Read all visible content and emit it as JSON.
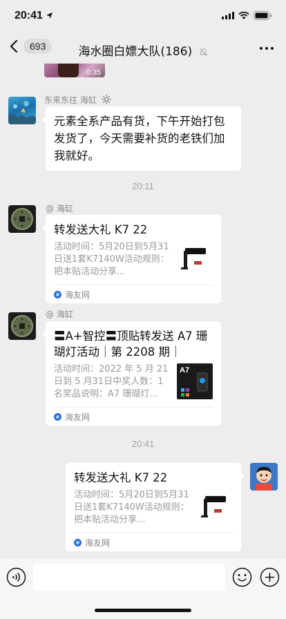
{
  "status_bar": {
    "time": "20:41"
  },
  "nav": {
    "unread_count": "693",
    "title": "海水圈白嫖大队(186)"
  },
  "messages": {
    "image_duration": "0:35",
    "m1_sender": "东来东往 海缸",
    "m1_text": "元素全系产品有货，下午开始打包发货了，今天需要补货的老铁们加我就好。",
    "time1": "20:11",
    "m2_sender": "@ 海缸",
    "m2_title": "转发送大礼 K7 22",
    "m2_desc": "活动时间：5月20日到5月31日送1套K7140W活动规则：把本贴活动分享...",
    "m2_source": "海友网",
    "m3_sender": "@ 海缸",
    "m3_title": "〓A+智控〓顶贴转发送 A7 珊瑚灯活动｜第 2208 期｜",
    "m3_desc": "活动时间：2022 年 5 月 21 日到 5 月31日中奖人数：1 名奖品说明：A7 珊瑚灯...",
    "m3_source": "海友网",
    "m3_thumb_label": "A7",
    "time2": "20:41",
    "m4_title": "转发送大礼 K7 22",
    "m4_desc": "活动时间：5月20日到5月31日送1套K7140W活动规则：把本贴活动分享...",
    "m4_source": "海友网"
  },
  "icons": {
    "sun": "sun-icon",
    "voice": "voice-icon",
    "emoji": "emoji-icon",
    "plus": "plus-icon",
    "mute": "mute-icon"
  },
  "colors": {
    "background": "#ededed",
    "bubble": "#ffffff",
    "muted_text": "#999999"
  }
}
